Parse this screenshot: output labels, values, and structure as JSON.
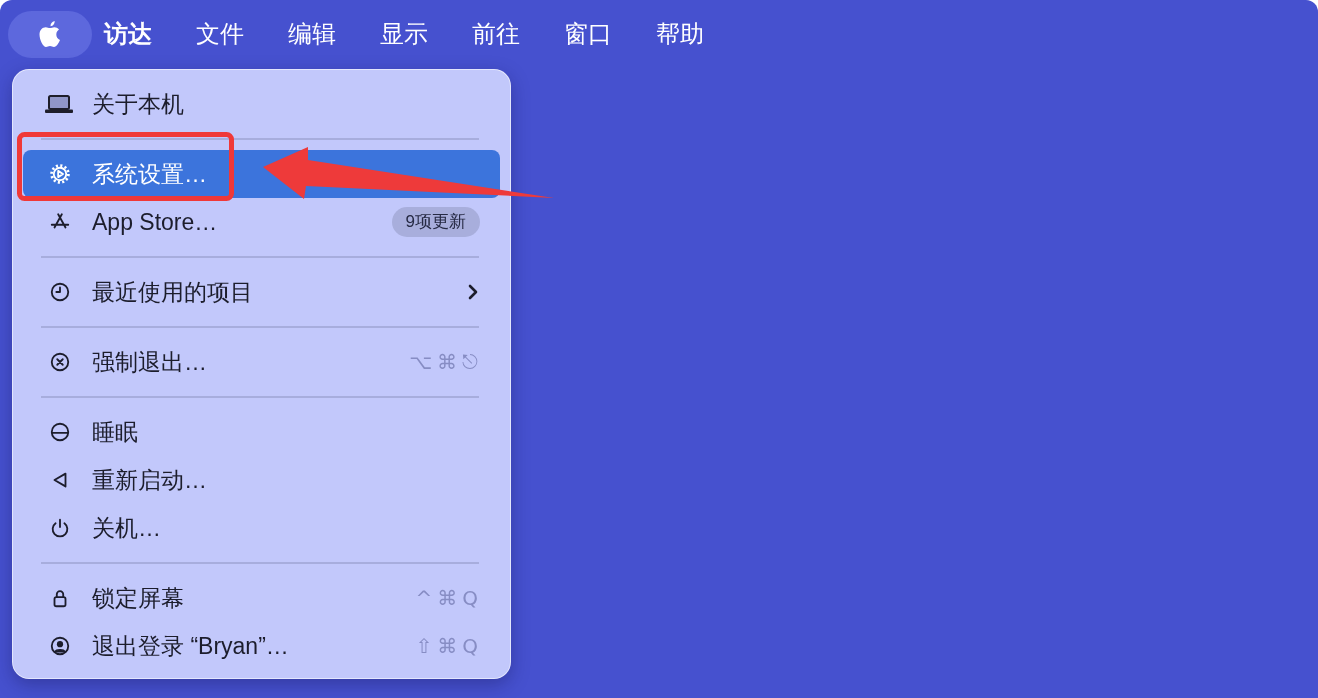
{
  "menu_bar": {
    "menus": [
      {
        "kind": "logo",
        "selected": true
      },
      {
        "kind": "app",
        "label": "访达",
        "selected": false
      },
      {
        "kind": "menu",
        "label": "文件",
        "selected": false
      },
      {
        "kind": "menu",
        "label": "编辑",
        "selected": false
      },
      {
        "kind": "menu",
        "label": "显示",
        "selected": false
      },
      {
        "kind": "menu",
        "label": "前往",
        "selected": false
      },
      {
        "kind": "menu",
        "label": "窗口",
        "selected": false
      },
      {
        "kind": "menu",
        "label": "帮助",
        "selected": false
      }
    ]
  },
  "apple_menu": {
    "items": [
      {
        "kind": "item",
        "label": "关于本机",
        "selected": false,
        "annotated": false,
        "submenu": false
      },
      {
        "kind": "separator"
      },
      {
        "kind": "item",
        "label": "系统设置…",
        "selected": true,
        "annotated": true,
        "submenu": false
      },
      {
        "kind": "item",
        "label": "App Store…",
        "selected": false,
        "annotated": false,
        "submenu": false,
        "badge": "9项更新"
      },
      {
        "kind": "separator"
      },
      {
        "kind": "item",
        "label": "最近使用的项目",
        "selected": false,
        "annotated": false,
        "submenu": true
      },
      {
        "kind": "separator"
      },
      {
        "kind": "item",
        "label": "强制退出…",
        "selected": false,
        "annotated": false,
        "submenu": false,
        "shortcut": "⌥⌘⎋"
      },
      {
        "kind": "separator"
      },
      {
        "kind": "item",
        "label": "睡眠",
        "selected": false,
        "annotated": false,
        "submenu": false
      },
      {
        "kind": "item",
        "label": "重新启动…",
        "selected": false,
        "annotated": false,
        "submenu": false
      },
      {
        "kind": "item",
        "label": "关机…",
        "selected": false,
        "annotated": false,
        "submenu": false
      },
      {
        "kind": "separator"
      },
      {
        "kind": "item",
        "label": "锁定屏幕",
        "selected": false,
        "annotated": false,
        "submenu": false,
        "shortcut": "^⌘Q"
      },
      {
        "kind": "item",
        "label": "退出登录 “Bryan”…",
        "selected": false,
        "annotated": false,
        "submenu": false,
        "shortcut": "⇧⌘Q"
      }
    ]
  }
}
